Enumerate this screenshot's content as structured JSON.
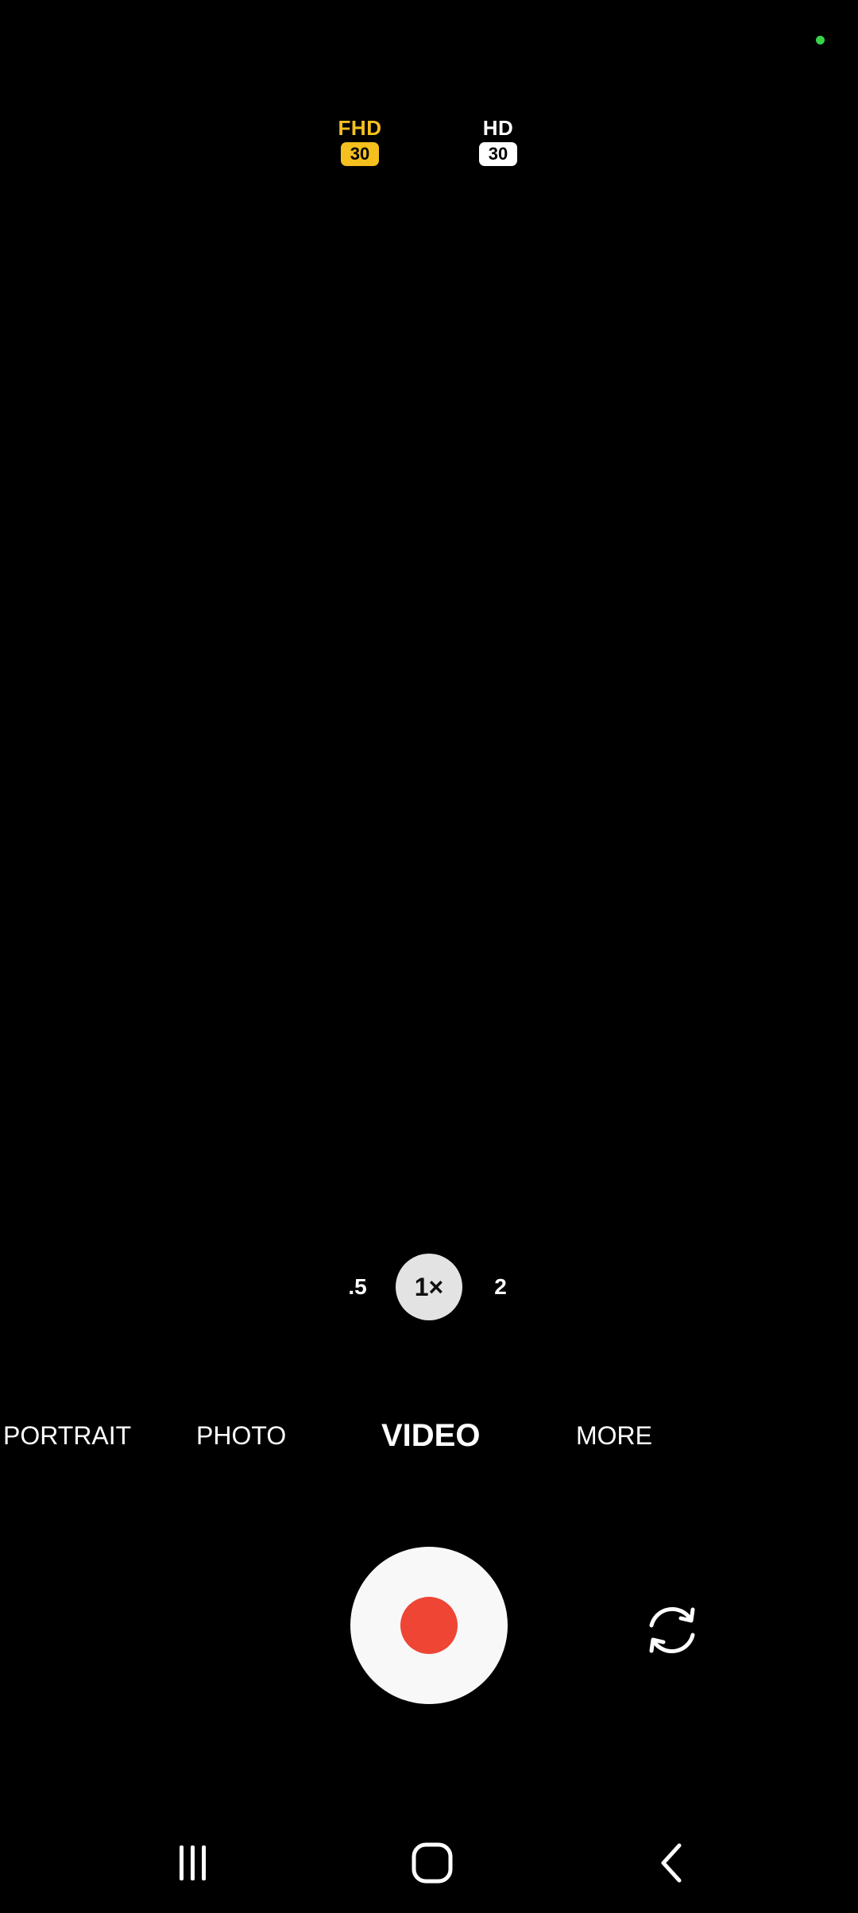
{
  "status": {
    "privacy_indicator_color": "#36d34a"
  },
  "resolution": {
    "options": [
      {
        "label": "FHD",
        "fps": "30",
        "selected": true,
        "color": "#f5c01e"
      },
      {
        "label": "HD",
        "fps": "30",
        "selected": false,
        "color": "#ffffff"
      }
    ]
  },
  "zoom": {
    "options": [
      ".5",
      "1×",
      "2"
    ],
    "selected": "1×"
  },
  "modes": {
    "items": [
      "PORTRAIT",
      "PHOTO",
      "VIDEO",
      "MORE"
    ],
    "selected": "VIDEO"
  },
  "controls": {
    "record_button_icon": "record-icon",
    "record_color": "#ee4535",
    "switch_camera_icon": "switch-camera-icon"
  },
  "navigation": {
    "icons": [
      "recents-icon",
      "home-icon",
      "back-icon"
    ]
  }
}
